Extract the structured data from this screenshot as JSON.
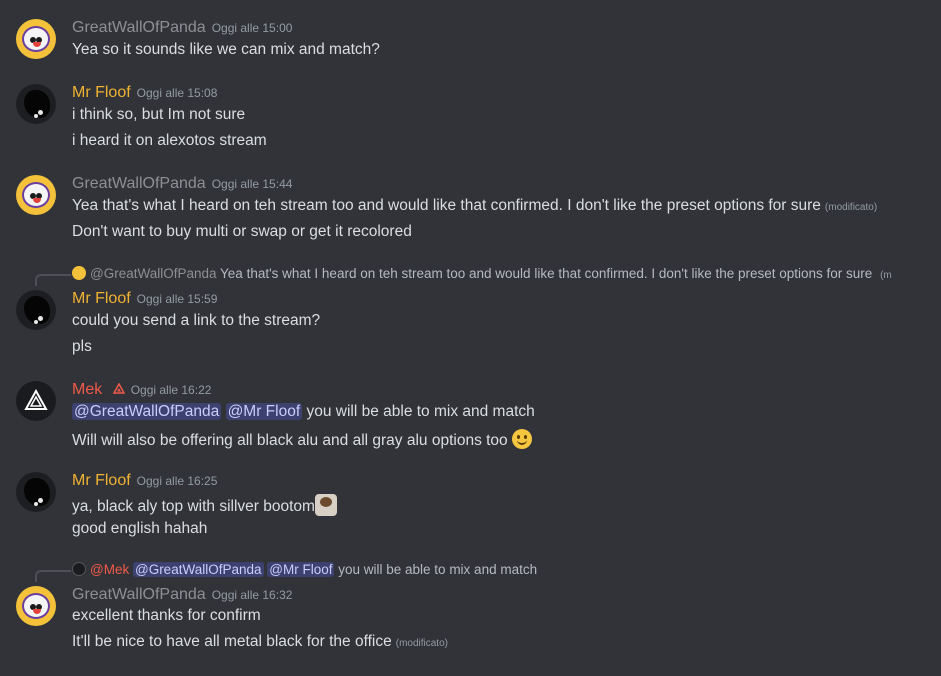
{
  "messages": [
    {
      "author": "GreatWallOfPanda",
      "timestamp": "Oggi alle 15:00",
      "lines": [
        "Yea so it sounds like we can mix and match?"
      ]
    },
    {
      "author": "Mr Floof",
      "timestamp": "Oggi alle 15:08",
      "lines": [
        "i think so, but Im not sure",
        "i heard it on alexotos stream"
      ]
    },
    {
      "author": "GreatWallOfPanda",
      "timestamp": "Oggi alle 15:44",
      "lines": [
        "Yea that's what I heard on teh stream too and would like that confirmed. I don't like the preset options for sure",
        "Don't want to buy multi or swap or get it recolored"
      ],
      "edited_label": "(modificato)"
    },
    {
      "reply": {
        "author": "@GreatWallOfPanda",
        "text": "Yea that's what I heard on teh stream too and would like that confirmed. I don't like the preset options for sure",
        "suffix": "(mo"
      },
      "author": "Mr Floof",
      "timestamp": "Oggi alle 15:59",
      "lines": [
        "could you send a link to the stream?",
        "pls"
      ]
    },
    {
      "author": "Mek",
      "timestamp": "Oggi alle 16:22",
      "mentions": [
        "@GreatWallOfPanda",
        "@Mr Floof"
      ],
      "lines": [
        "you will be able to mix and match",
        "Will will also be offering all black alu and all gray alu options too"
      ],
      "emoji": "slightly-smiling-emoji"
    },
    {
      "author": "Mr Floof",
      "timestamp": "Oggi alle 16:25",
      "lines": [
        "ya, black aly top with sillver bootom",
        "good english hahah"
      ],
      "emoji": "custom-emoji"
    },
    {
      "reply": {
        "author": "@Mek",
        "mentions": [
          "@GreatWallOfPanda",
          "@Mr Floof"
        ],
        "text": "you will be able to mix and match"
      },
      "author": "GreatWallOfPanda",
      "timestamp": "Oggi alle 16:32",
      "lines": [
        "excellent thanks for confirm",
        "It'll be nice to have all metal black for the office"
      ],
      "edited_label": "(modificato)"
    }
  ],
  "colors": {
    "background": "#313338",
    "panda_name": "#8d8f95",
    "floof_name": "#f0b232",
    "mek_name": "#f05a4a",
    "mention_bg": "#3c4270"
  }
}
